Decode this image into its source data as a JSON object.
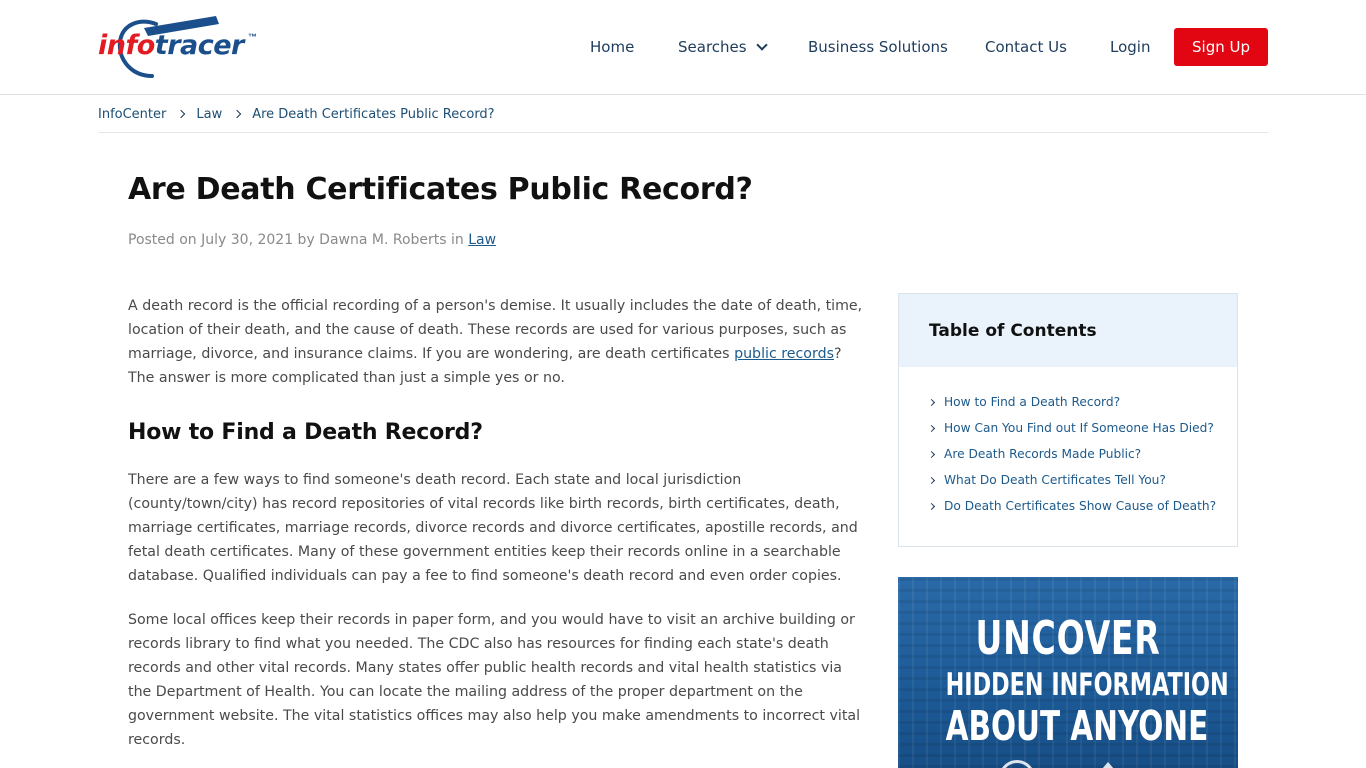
{
  "header": {
    "logo": {
      "part1": "info",
      "part2": "tracer",
      "tm": "™"
    },
    "nav": {
      "home": "Home",
      "searches": "Searches",
      "business": "Business Solutions",
      "contact": "Contact Us",
      "login": "Login",
      "signup": "Sign Up"
    }
  },
  "breadcrumb": {
    "items": [
      "InfoCenter",
      "Law"
    ],
    "current": "Are Death Certificates Public Record?"
  },
  "post": {
    "title": "Are Death Certificates Public Record?",
    "meta_prefix": "Posted on July 30, 2021 by Dawna M. Roberts in ",
    "category": "Law"
  },
  "article": {
    "p1_before": "A death record is the official recording of a person's demise. It usually includes the date of death, time, location of their death, and the cause of death. These records are used for various purposes, such as marriage, divorce, and insurance claims. If you are wondering, are death certificates ",
    "p1_link": "public records",
    "p1_after": "? The answer is more complicated than just a simple yes or no.",
    "h2_1": "How to Find a Death Record?",
    "p2": "There are a few ways to find someone's death record. Each state and local jurisdiction (county/town/city) has record repositories of vital records like birth records, birth certificates, death, marriage certificates, marriage records, divorce records and divorce certificates, apostille records, and fetal death certificates. Many of these government entities keep their records online in a searchable database. Qualified individuals can pay a fee to find someone's death record and even order copies.",
    "p3": "Some local offices keep their records in paper form, and you would have to visit an archive building or records library to find what you needed. The CDC also has resources for finding each state's death records and other vital records. Many states offer public health records and vital health statistics via the Department of Health. You can locate the mailing address of the proper department on the government website. The vital statistics offices may also help you make amendments to incorrect vital records."
  },
  "toc": {
    "title": "Table of Contents",
    "items": [
      "How to Find a Death Record?",
      "How Can You Find out If Someone Has Died?",
      "Are Death Records Made Public?",
      "What Do Death Certificates Tell You?",
      "Do Death Certificates Show Cause of Death?"
    ]
  },
  "ad": {
    "line1": "UNCOVER",
    "line2": "HIDDEN INFORMATION",
    "line3": "ABOUT ANYONE"
  },
  "colors": {
    "brand_red": "#e20613",
    "brand_blue": "#1a4f8c",
    "link": "#1d5a8c",
    "toc_header_bg": "#eaf3fb",
    "ad_bg": "#1e5f9c"
  }
}
